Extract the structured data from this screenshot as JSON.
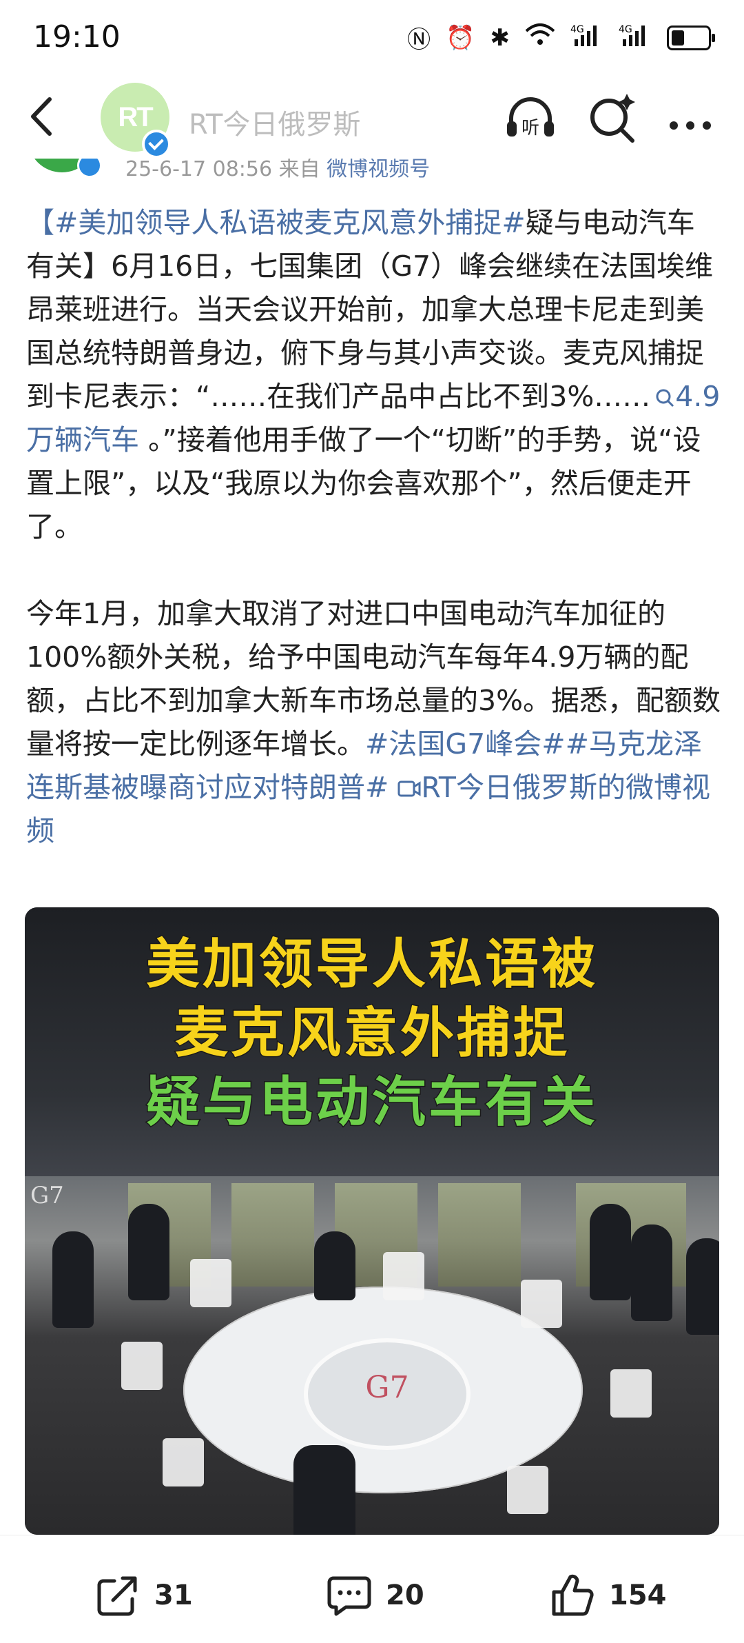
{
  "status_bar": {
    "time": "19:10",
    "icons": [
      "nfc-icon",
      "alarm-icon",
      "bluetooth-icon",
      "wifi-icon",
      "signal-4g-icon",
      "signal-4g-icon",
      "battery-icon"
    ],
    "battery_level": 0.4
  },
  "header": {
    "account_name": "RT今日俄罗斯",
    "avatar_text": "RT",
    "icons": [
      "back-icon",
      "listen-icon",
      "search-icon",
      "more-icon"
    ]
  },
  "meta": {
    "date": "25-6-17 08:56",
    "source_prefix": "来自",
    "source": "微博视频号"
  },
  "post": {
    "p1_tag": "【#美加领导人私语被麦克风意外捕捉#",
    "p1_text": "疑与电动汽车有关】6月16日，七国集团（G7）峰会继续在法国埃维昂莱班进行。当天会议开始前，加拿大总理卡尼走到美国总统特朗普身边，俯下身与其小声交谈。麦克风捕捉到卡尼表示：“……在我们产品中占比不到3%……",
    "p1_link": "4.9万辆汽车",
    "p1_text2": " 。”接着他用手做了一个“切断”的手势，说“设置上限”，以及“我原以为你会喜欢那个”，然后便走开了。",
    "p2_text": "今年1月，加拿大取消了对进口中国电动汽车加征的100%额外关税，给予中国电动汽车每年4.9万辆的配额，占比不到加拿大新车市场总量的3%。据悉，配额数量将按一定比例逐年增长。",
    "p2_tags": "#法国G7峰会##马克龙泽连斯基被曝商讨应对特朗普#",
    "p2_video_link": "RT今日俄罗斯的微博视频"
  },
  "video": {
    "caption_line1": "美加领导人私语被",
    "caption_line2": "麦克风意外捕捉",
    "caption_line3": "疑与电动汽车有关",
    "scene_logo": "G7",
    "table_logo": "G7"
  },
  "actions": {
    "share_count": "31",
    "comment_count": "20",
    "like_count": "154"
  },
  "colors": {
    "link": "#4a6fa5",
    "caption_yellow": "#f7d31b",
    "caption_green": "#6dd04a",
    "verified": "#2b8ae0"
  }
}
